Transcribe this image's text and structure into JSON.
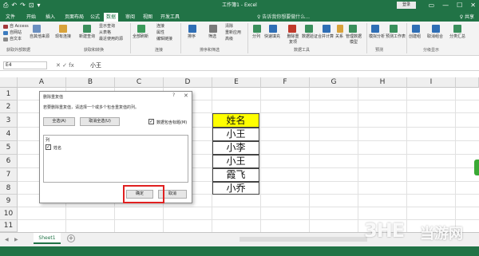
{
  "titlebar": {
    "title": "工作簿1 - Excel",
    "signin": "登录",
    "qat": [
      "⎙",
      "↶",
      "↷",
      "⊡",
      "▾"
    ],
    "controls": [
      "▭",
      "—",
      "☐",
      "✕"
    ]
  },
  "tabs": [
    "文件",
    "开始",
    "插入",
    "页面布局",
    "公式",
    "数据",
    "审阅",
    "视图",
    "开发工具"
  ],
  "tellme": "♀ 告诉我你想要做什么...",
  "share": "♀ 共享",
  "ribbon": {
    "items": [
      "自 Access",
      "自网站",
      "自文本",
      "自其他来源",
      "现有连接",
      "新建查询",
      "显示查询",
      "从表格",
      "最近使用的源",
      "全部刷新",
      "连接",
      "属性",
      "编辑链接",
      "排序",
      "筛选",
      "清除",
      "重新应用",
      "高级",
      "分列",
      "快速填充",
      "删除重复项",
      "数据验证",
      "合并计算",
      "管理数据模型",
      "关系",
      "模拟分析",
      "预测工作表",
      "创建组",
      "取消组合",
      "分类汇总"
    ],
    "groups": [
      "获取外部数据",
      "获取和转换",
      "连接",
      "排序和筛选",
      "数据工具",
      "预测",
      "分级显示"
    ]
  },
  "formula": {
    "namebox": "E4",
    "fx_symbols": "✕ ✓ fx",
    "value": "小王"
  },
  "columns": [
    "A",
    "B",
    "C",
    "D",
    "E",
    "F",
    "G",
    "H",
    "I"
  ],
  "rows": [
    "1",
    "2",
    "3",
    "4",
    "5",
    "6",
    "7",
    "8",
    "9",
    "10",
    "11"
  ],
  "table": {
    "header": "姓名",
    "values": [
      "小王",
      "小李",
      "小王",
      "霞飞",
      "小乔"
    ]
  },
  "dialog": {
    "title": "删除重复值",
    "help": "?",
    "close": "✕",
    "description": "若要删除重复值，请选择一个或多个包含重复值的列。",
    "select_all": "全选(A)",
    "unselect_all": "取消全选(U)",
    "has_headers": "数据包含标题(M)",
    "list_header": "列",
    "list_item": "姓名",
    "ok": "确定",
    "cancel": "取消"
  },
  "sheet": {
    "name": "Sheet1",
    "add": "+",
    "nav": [
      "◀",
      "▶"
    ]
  },
  "watermark": {
    "latin": "3HE",
    "cjk": "当游网"
  },
  "colors": {
    "excel_green": "#217346",
    "header_fill": "#ffff00",
    "highlight": "#e02020"
  }
}
